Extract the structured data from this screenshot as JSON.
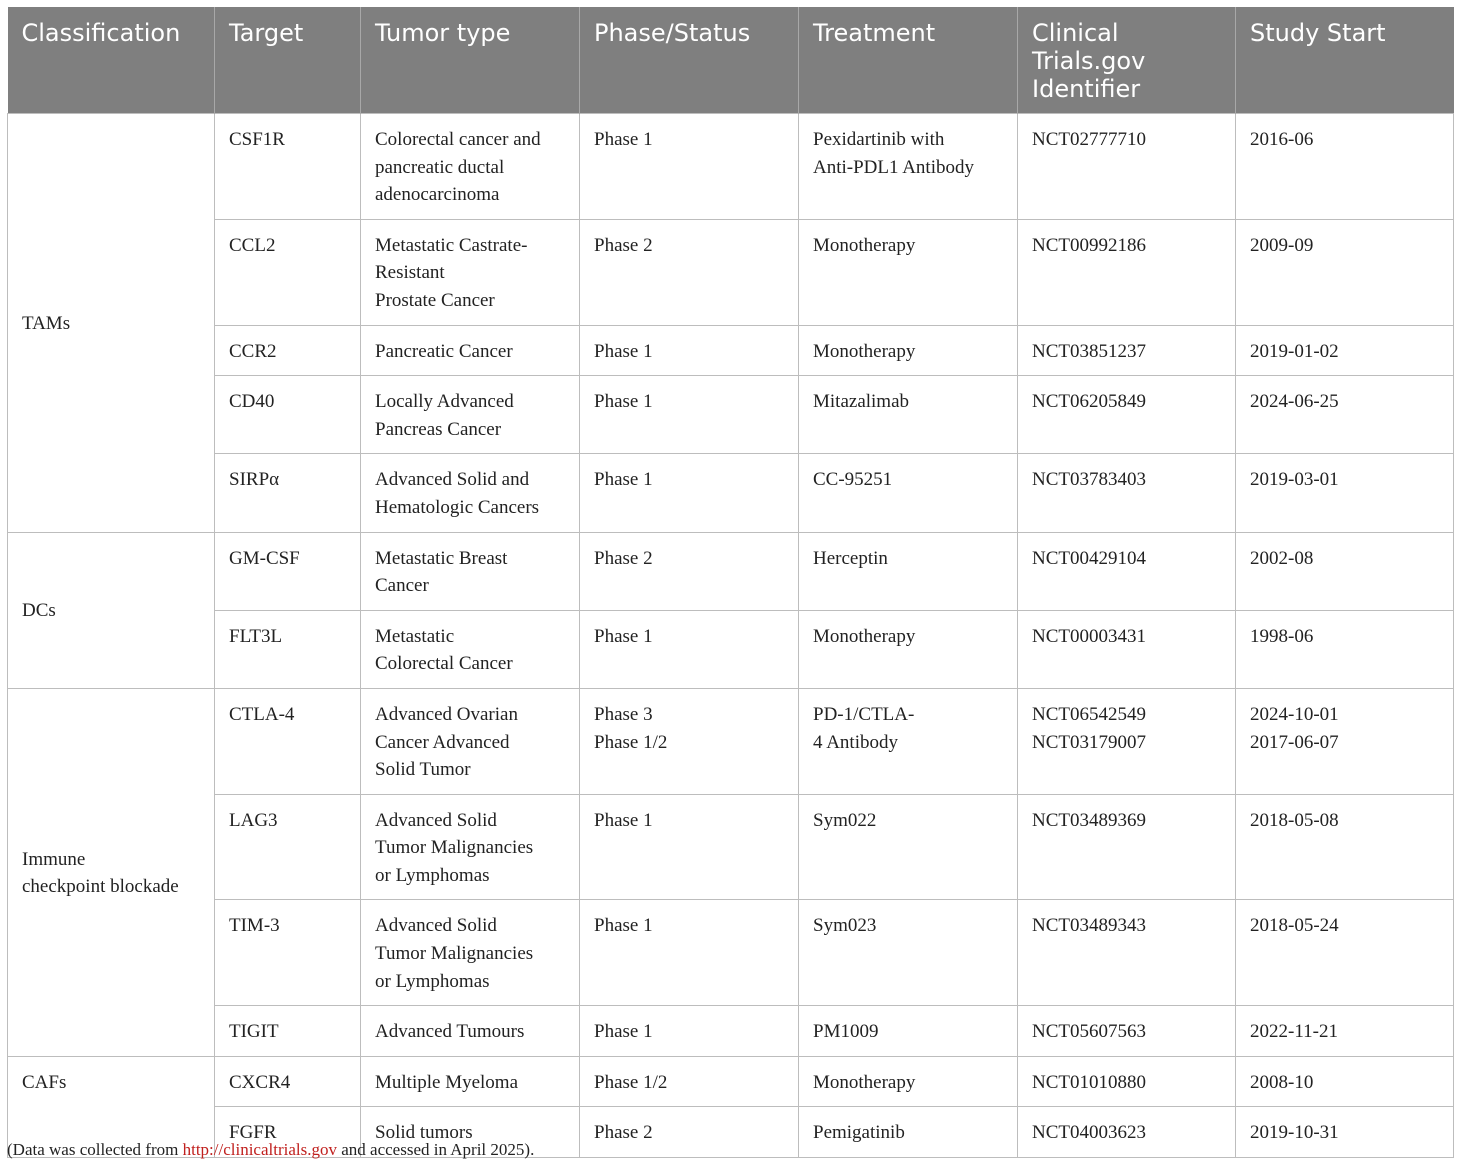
{
  "headers": {
    "classification": "Classification",
    "target": "Target",
    "tumor_type": "Tumor type",
    "phase": "Phase/Status",
    "treatment": "Treatment",
    "identifier": "Clinical\nTrials.gov\nIdentifier",
    "study_start": "Study Start"
  },
  "groups": {
    "tams": "TAMs",
    "dcs": "DCs",
    "icb": "Immune\ncheckpoint blockade",
    "cafs": "CAFs"
  },
  "rows": [
    {
      "target": "CSF1R",
      "tumor": "Colorectal cancer and\npancreatic ductal\nadenocarcinoma",
      "phase": "Phase 1",
      "treatment": "Pexidartinib with\nAnti-PDL1 Antibody",
      "id": "NCT02777710",
      "start": "2016-06"
    },
    {
      "target": "CCL2",
      "tumor": "Metastatic Castrate-\nResistant\nProstate Cancer",
      "phase": "Phase 2",
      "treatment": "Monotherapy",
      "id": "NCT00992186",
      "start": "2009-09"
    },
    {
      "target": "CCR2",
      "tumor": "Pancreatic Cancer",
      "phase": "Phase 1",
      "treatment": "Monotherapy",
      "id": "NCT03851237",
      "start": "2019-01-02"
    },
    {
      "target": "CD40",
      "tumor": "Locally Advanced\nPancreas Cancer",
      "phase": "Phase 1",
      "treatment": "Mitazalimab",
      "id": "NCT06205849",
      "start": "2024-06-25"
    },
    {
      "target": "SIRPα",
      "tumor": "Advanced Solid and\nHematologic Cancers",
      "phase": "Phase 1",
      "treatment": "CC-95251",
      "id": "NCT03783403",
      "start": "2019-03-01"
    },
    {
      "target": "GM-CSF",
      "tumor": "Metastatic Breast\nCancer",
      "phase": "Phase 2",
      "treatment": "Herceptin",
      "id": "NCT00429104",
      "start": "2002-08"
    },
    {
      "target": "FLT3L",
      "tumor": "Metastatic\nColorectal Cancer",
      "phase": "Phase 1",
      "treatment": "Monotherapy",
      "id": "NCT00003431",
      "start": "1998-06"
    },
    {
      "target": "CTLA-4",
      "tumor": "Advanced Ovarian\nCancer Advanced\nSolid Tumor",
      "phase": "Phase 3\nPhase 1/2",
      "treatment": "PD-1/CTLA-\n4 Antibody",
      "id": "NCT06542549\nNCT03179007",
      "start": "2024-10-01\n2017-06-07"
    },
    {
      "target": "LAG3",
      "tumor": "Advanced Solid\nTumor Malignancies\nor Lymphomas",
      "phase": "Phase 1",
      "treatment": "Sym022",
      "id": "NCT03489369",
      "start": "2018-05-08"
    },
    {
      "target": "TIM-3",
      "tumor": "Advanced Solid\nTumor Malignancies\nor Lymphomas",
      "phase": "Phase 1",
      "treatment": "Sym023",
      "id": "NCT03489343",
      "start": "2018-05-24"
    },
    {
      "target": "TIGIT",
      "tumor": "Advanced Tumours",
      "phase": "Phase 1",
      "treatment": "PM1009",
      "id": "NCT05607563",
      "start": "2022-11-21"
    },
    {
      "target": "CXCR4",
      "tumor": "Multiple Myeloma",
      "phase": "Phase 1/2",
      "treatment": "Monotherapy",
      "id": "NCT01010880",
      "start": "2008-10"
    },
    {
      "target": "FGFR",
      "tumor": "Solid tumors",
      "phase": "Phase 2",
      "treatment": "Pemigatinib",
      "id": "NCT04003623",
      "start": "2019-10-31"
    }
  ],
  "footnote": {
    "prefix": "(Data was collected from ",
    "link": "http://clinicaltrials.gov",
    "suffix": " and accessed in April 2025)."
  }
}
